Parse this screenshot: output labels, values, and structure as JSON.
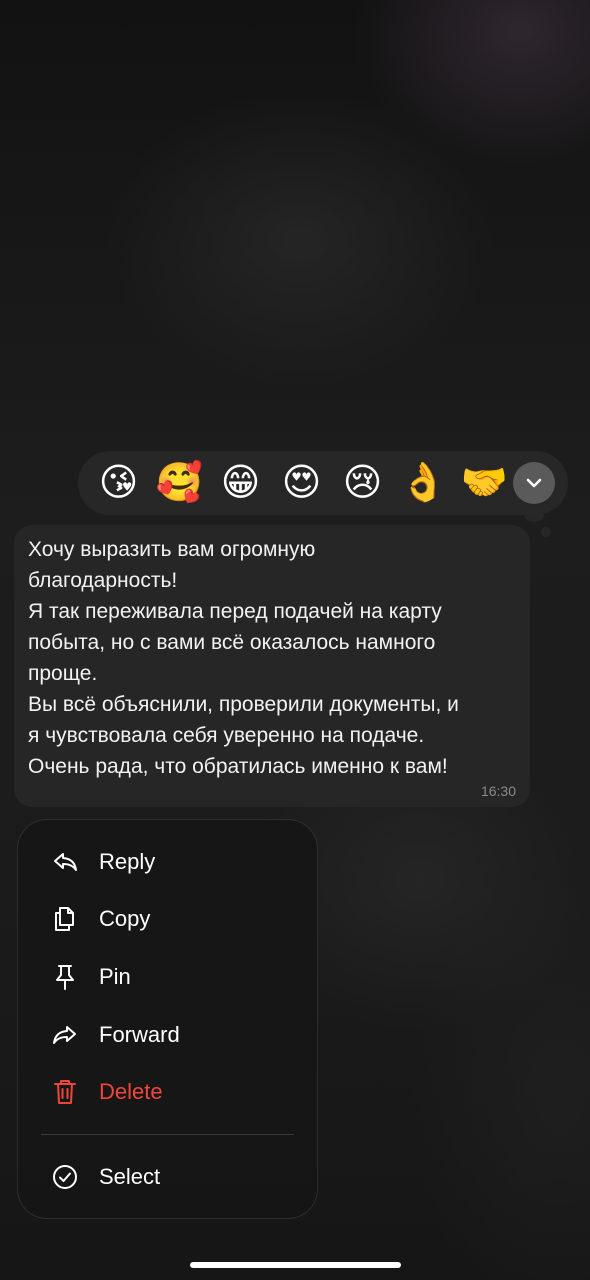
{
  "reactions": {
    "emojis": [
      "😘",
      "🥰",
      "😁",
      "😍",
      "😢",
      "👌",
      "🤝"
    ],
    "expand_icon": "chevron-down-icon"
  },
  "message": {
    "text": "Хочу выразить вам огромную\nблагодарность!\nЯ так переживала перед подачей на карту\nпобыта, но с вами всё оказалось намного\nпроще.\nВы всё объяснили, проверили документы, и\nя чувствовала себя уверенно на подаче.\nОчень рада, что обратилась именно к вам!",
    "time": "16:30"
  },
  "menu": {
    "items": [
      {
        "label": "Reply",
        "icon": "reply-icon"
      },
      {
        "label": "Copy",
        "icon": "copy-icon"
      },
      {
        "label": "Pin",
        "icon": "pin-icon"
      },
      {
        "label": "Forward",
        "icon": "forward-icon"
      },
      {
        "label": "Delete",
        "icon": "trash-icon",
        "color": "#f0453a"
      },
      {
        "label": "Select",
        "icon": "check-circle-icon"
      }
    ]
  },
  "colors": {
    "accent_danger": "#f0453a",
    "bubble": "#262626",
    "menu_bg": "#161616"
  }
}
